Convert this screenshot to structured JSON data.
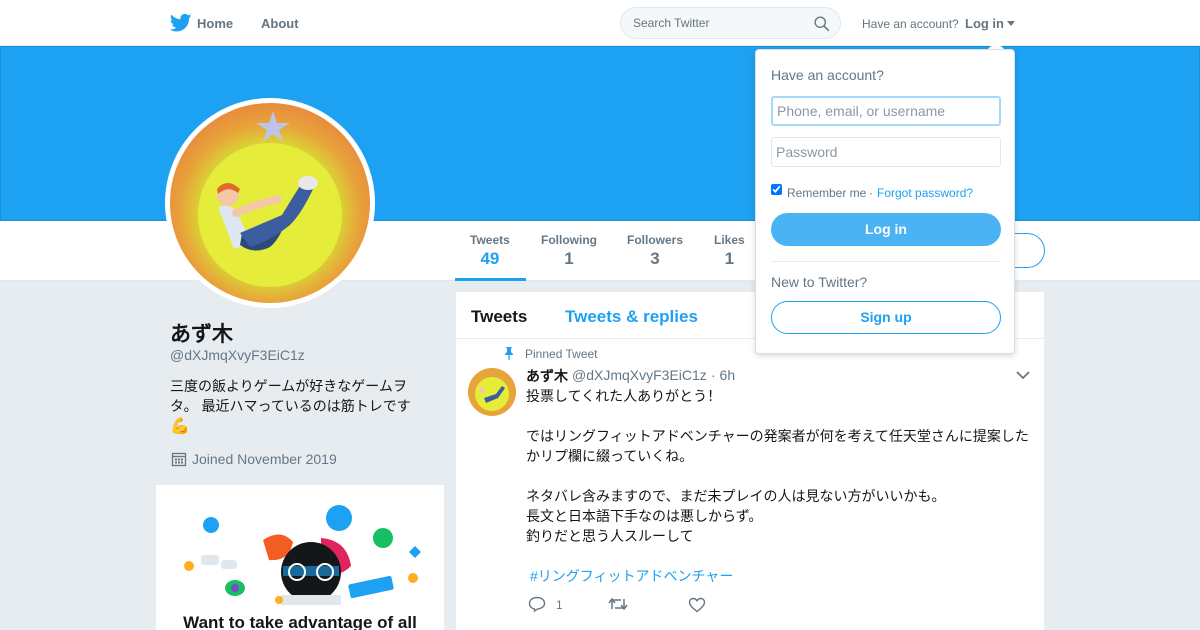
{
  "nav": {
    "home": "Home",
    "about": "About",
    "search_placeholder": "Search Twitter",
    "have_account": "Have an account?",
    "login": "Log in"
  },
  "colors": {
    "brand_blue": "#1da1f2",
    "banner": "#1da1f2",
    "background": "#e6ecf0",
    "muted_text": "#657786"
  },
  "profile": {
    "name": "あず木",
    "handle": "@dXJmqXvyF3EiC1z",
    "bio_line1": "三度の飯よりゲームが好きなゲームヲ",
    "bio_line2": "タ。 最近ハマっているのは筋トレです",
    "bio_emoji": "💪",
    "joined": "Joined November 2019"
  },
  "stats": [
    {
      "label": "Tweets",
      "value": "49"
    },
    {
      "label": "Following",
      "value": "1"
    },
    {
      "label": "Followers",
      "value": "3"
    },
    {
      "label": "Likes",
      "value": "1"
    }
  ],
  "promo": {
    "title": "Want to take advantage of all"
  },
  "timeline": {
    "tab_tweets": "Tweets",
    "tab_replies": "Tweets & replies",
    "tweet": {
      "pinned_label": "Pinned Tweet",
      "author": "あず木",
      "handle": "@dXJmqXvyF3EiC1z",
      "time": "· 6h",
      "lines": [
        "投票してくれた人ありがとう！",
        "",
        "ではリングフィットアドベンチャーの発案者が何を考えて任天堂さんに提案したかリプ欄に綴っていくね。",
        "",
        "ネタバレ含みますので、まだ未プレイの人は見ない方がいいかも。",
        "長文と日本語下手なのは悪しからず。",
        "釣りだと思う人スルーして"
      ],
      "hashtag": "#リングフィットアドベンチャー",
      "reply_count": "1"
    }
  },
  "login_dropdown": {
    "title": "Have an account?",
    "username_placeholder": "Phone, email, or username",
    "password_placeholder": "Password",
    "remember_me": "Remember me",
    "separator": "·",
    "forgot_password": "Forgot password?",
    "login_button": "Log in",
    "new_to_twitter": "New to Twitter?",
    "signup_button": "Sign up"
  }
}
